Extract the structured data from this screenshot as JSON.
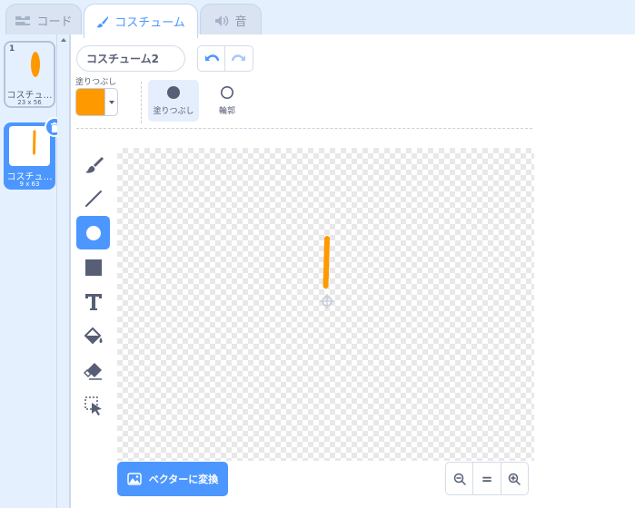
{
  "tabs": [
    {
      "label": "コード",
      "icon": "code-blocks-icon"
    },
    {
      "label": "コスチューム",
      "icon": "paintbrush-icon"
    },
    {
      "label": "音",
      "icon": "speaker-icon"
    }
  ],
  "costumes": [
    {
      "number": "1",
      "name": "コスチュ…",
      "size": "23 x 56"
    },
    {
      "number": "2",
      "name": "コスチュ…",
      "size": "9 x 63"
    }
  ],
  "editor": {
    "costume_name": "コスチューム2",
    "fill_label": "塗りつぶし",
    "fill_color": "#ff9900",
    "fill_mode_label": "塗りつぶし",
    "outline_mode_label": "輪郭",
    "convert_label": "ベクターに変換",
    "zoom_reset_label": "="
  },
  "tools": [
    "brush-icon",
    "line-icon",
    "circle-icon",
    "rectangle-icon",
    "text-icon",
    "fill-bucket-icon",
    "eraser-icon",
    "select-icon"
  ],
  "colors": {
    "accent": "#4c97ff",
    "costume": "#ff9900"
  }
}
